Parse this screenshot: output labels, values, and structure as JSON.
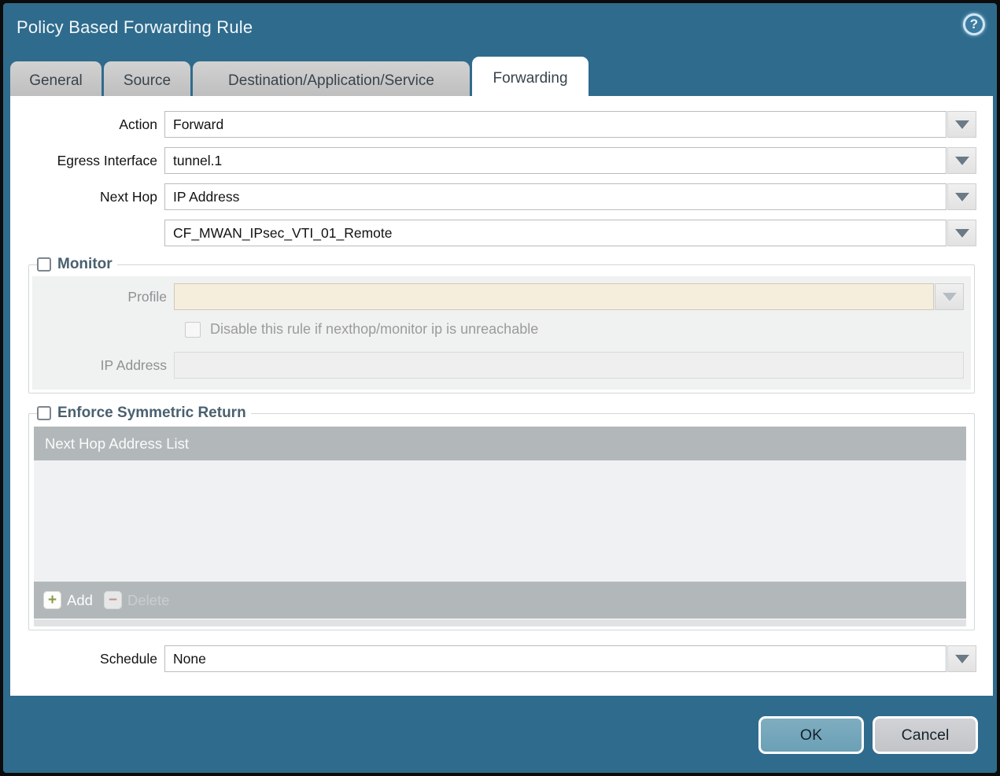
{
  "dialog": {
    "title": "Policy Based Forwarding Rule"
  },
  "icons": {
    "help": "?",
    "add_glyph": "+",
    "delete_glyph": "−"
  },
  "tabs": [
    {
      "label": "General",
      "active": false
    },
    {
      "label": "Source",
      "active": false
    },
    {
      "label": "Destination/Application/Service",
      "active": false
    },
    {
      "label": "Forwarding",
      "active": true
    }
  ],
  "fields": {
    "action": {
      "label": "Action",
      "value": "Forward"
    },
    "egress_interface": {
      "label": "Egress Interface",
      "value": "tunnel.1"
    },
    "next_hop": {
      "label": "Next Hop",
      "value": "IP Address"
    },
    "next_hop_address": {
      "value": "CF_MWAN_IPsec_VTI_01_Remote"
    },
    "schedule": {
      "label": "Schedule",
      "value": "None"
    }
  },
  "monitor": {
    "legend": "Monitor",
    "checked": false,
    "profile": {
      "label": "Profile",
      "value": ""
    },
    "disable_rule_checkbox": {
      "label": "Disable this rule if nexthop/monitor ip is unreachable",
      "checked": false
    },
    "ip_address": {
      "label": "IP Address",
      "value": ""
    }
  },
  "symmetric_return": {
    "legend": "Enforce Symmetric Return",
    "checked": false,
    "table": {
      "header": "Next Hop Address List",
      "rows": []
    },
    "add_label": "Add",
    "delete_label": "Delete",
    "delete_enabled": false
  },
  "footer": {
    "ok_label": "OK",
    "cancel_label": "Cancel"
  },
  "colors": {
    "chrome_teal": "#2f6b8d",
    "active_tab_bg": "#ffffff",
    "inactive_tab_bg": "#c6c6c6",
    "disabled_field_beige": "#f5eedc",
    "table_bar_gray": "#b2b7ba",
    "ok_button": "#6ba0b6",
    "add_plus_green": "#8a9a45",
    "delete_minus_red": "#c98f8f"
  }
}
